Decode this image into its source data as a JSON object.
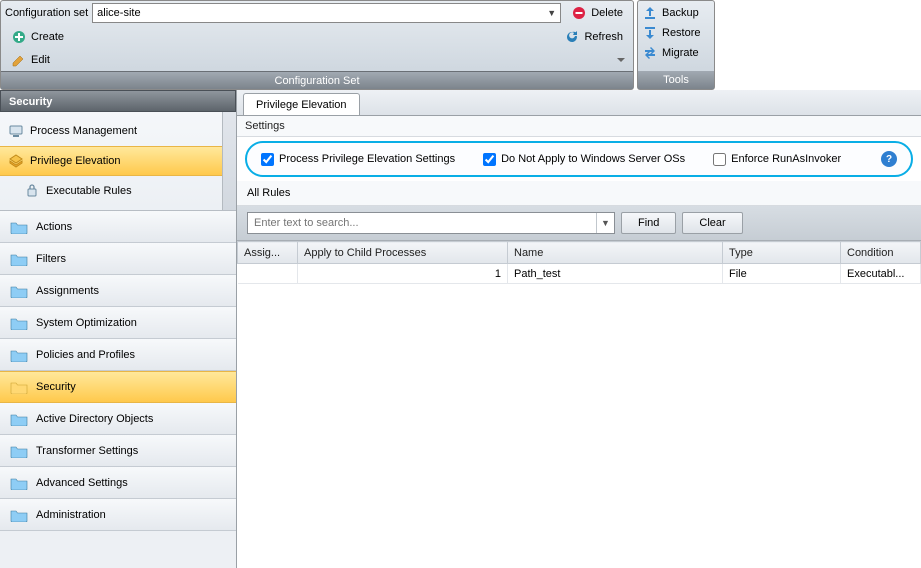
{
  "toolbar": {
    "config_set_label": "Configuration set",
    "config_set_value": "alice-site",
    "delete": "Delete",
    "create": "Create",
    "refresh": "Refresh",
    "edit": "Edit",
    "panel_title": "Configuration Set"
  },
  "tools": {
    "backup": "Backup",
    "restore": "Restore",
    "migrate": "Migrate",
    "panel_title": "Tools"
  },
  "sidebar": {
    "header": "Security",
    "tree": [
      {
        "label": "Process Management",
        "selected": false,
        "child": false
      },
      {
        "label": "Privilege Elevation",
        "selected": true,
        "child": false
      },
      {
        "label": "Executable Rules",
        "selected": false,
        "child": true
      }
    ],
    "nav": [
      {
        "label": "Actions",
        "selected": false
      },
      {
        "label": "Filters",
        "selected": false
      },
      {
        "label": "Assignments",
        "selected": false
      },
      {
        "label": "System Optimization",
        "selected": false
      },
      {
        "label": "Policies and Profiles",
        "selected": false
      },
      {
        "label": "Security",
        "selected": true
      },
      {
        "label": "Active Directory Objects",
        "selected": false
      },
      {
        "label": "Transformer Settings",
        "selected": false
      },
      {
        "label": "Advanced Settings",
        "selected": false
      },
      {
        "label": "Administration",
        "selected": false
      }
    ]
  },
  "content": {
    "tab": "Privilege Elevation",
    "settings_label": "Settings",
    "checkboxes": {
      "process_priv": {
        "label": "Process Privilege Elevation Settings",
        "checked": true
      },
      "no_server": {
        "label": "Do Not Apply to Windows Server OSs",
        "checked": true
      },
      "runas": {
        "label": "Enforce RunAsInvoker",
        "checked": false
      }
    },
    "all_rules_label": "All Rules",
    "search_placeholder": "Enter text to search...",
    "find": "Find",
    "clear": "Clear",
    "columns": [
      "Assig...",
      "Apply to Child Processes",
      "Name",
      "Type",
      "Condition"
    ],
    "rows": [
      {
        "assign": "",
        "apply": "1",
        "name": "Path_test",
        "type": "File",
        "condition": "Executabl..."
      }
    ]
  }
}
